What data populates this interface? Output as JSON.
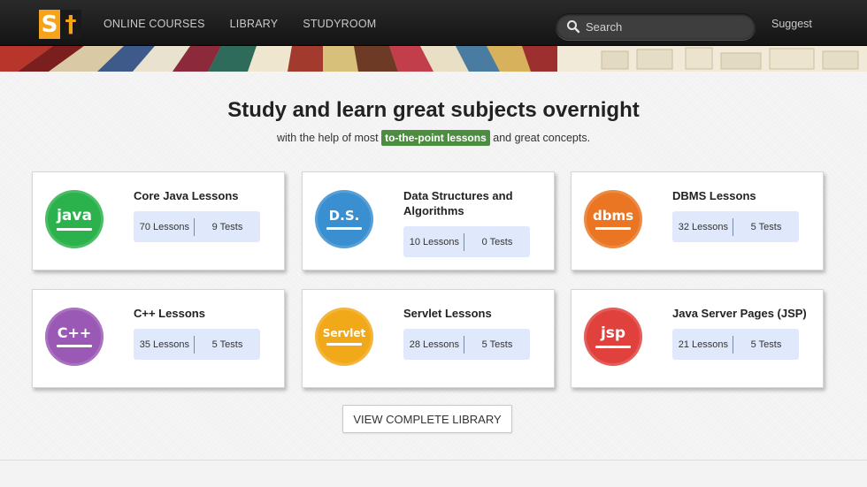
{
  "nav": {
    "logo_left": "S",
    "logo_right": "†",
    "links": [
      "ONLINE COURSES",
      "LIBRARY",
      "STUDYROOM"
    ],
    "search_placeholder": "Search",
    "suggest": "Suggest"
  },
  "hero": {
    "headline": "Study and learn great subjects overnight",
    "sub_before": "with the help of most",
    "sub_highlight": "to-the-point lessons",
    "sub_after": "and great concepts."
  },
  "courses": [
    {
      "title": "Core Java Lessons",
      "badge": "java",
      "badge_color": "#2bb24c",
      "lessons": "70 Lessons",
      "tests": "9 Tests"
    },
    {
      "title": "Data Structures and Algorithms",
      "badge": "D.S.",
      "badge_color": "#3a8fd0",
      "lessons": "10 Lessons",
      "tests": "0 Tests"
    },
    {
      "title": "DBMS Lessons",
      "badge": "dbms",
      "badge_color": "#ea7624",
      "lessons": "32 Lessons",
      "tests": "5 Tests"
    },
    {
      "title": "C++ Lessons",
      "badge": "C++",
      "badge_color": "#9b59b6",
      "lessons": "35 Lessons",
      "tests": "5 Tests"
    },
    {
      "title": "Servlet Lessons",
      "badge": "Servlet",
      "badge_color": "#f1a91a",
      "lessons": "28 Lessons",
      "tests": "5 Tests"
    },
    {
      "title": "Java Server Pages (JSP)",
      "badge": "jsp",
      "badge_color": "#e0413c",
      "lessons": "21 Lessons",
      "tests": "5 Tests"
    }
  ],
  "view_library": "VIEW COMPLETE LIBRARY"
}
